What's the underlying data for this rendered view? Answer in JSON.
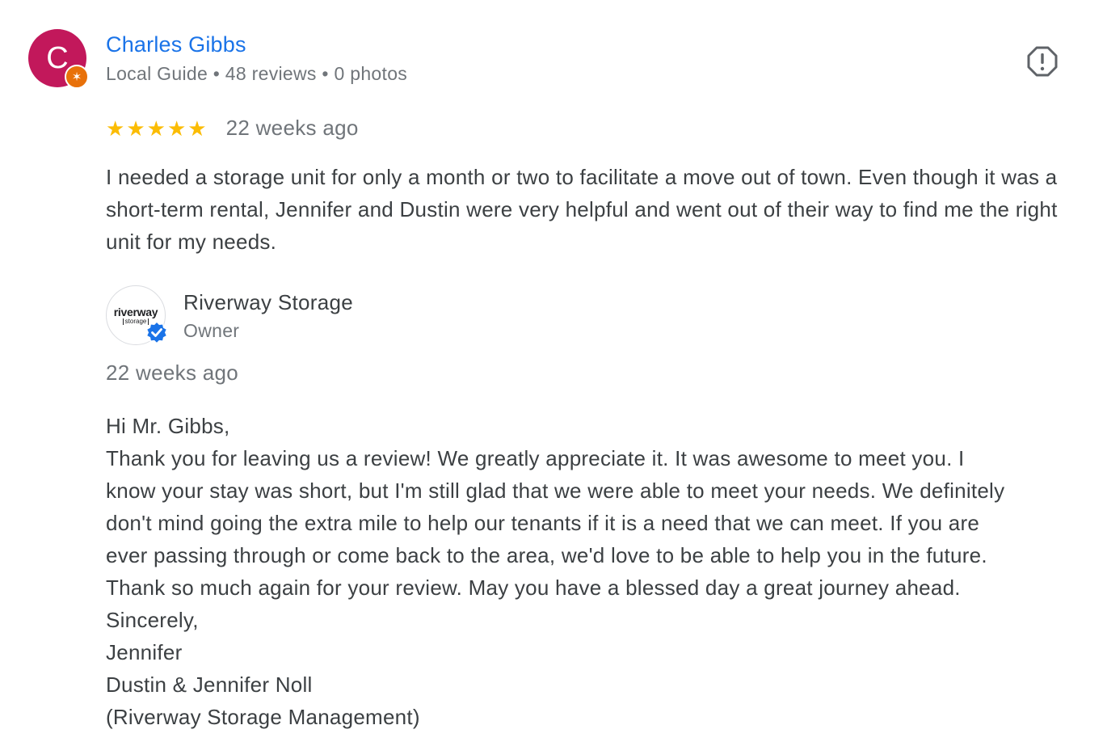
{
  "review": {
    "reviewer": {
      "initial": "C",
      "name": "Charles Gibbs",
      "meta": "Local Guide • 48 reviews • 0 photos",
      "badge_icon": "local-guide-star-icon",
      "avatar_color": "#c2185b",
      "badge_color": "#e8710a"
    },
    "rating": 5,
    "stars": [
      "★",
      "★",
      "★",
      "★",
      "★"
    ],
    "time": "22 weeks ago",
    "text": "I needed a storage unit for only a month or two to facilitate a move out of town. Even though it was a short-term rental, Jennifer and Dustin were very helpful and went out of their way to find me the right unit for my needs.",
    "flag_icon": "report-flag-icon"
  },
  "response": {
    "logo_word": "riverway",
    "logo_sub": "storage",
    "name": "Riverway Storage",
    "role": "Owner",
    "verified_icon": "verified-check-icon",
    "time": "22 weeks ago",
    "lines": [
      "Hi Mr. Gibbs,",
      "Thank you for leaving us a review! We greatly appreciate it. It was awesome to meet you. I",
      "know your stay was short, but I'm still glad that we were able to meet your needs. We definitely",
      "don't mind going the extra mile to help our tenants if it is a need that we can meet. If you are",
      "ever passing through or come back to the area, we'd love to be able to help you in the future.",
      "Thank so much again for your review. May you have a blessed day a great journey ahead.",
      "Sincerely,",
      "Jennifer",
      "Dustin & Jennifer Noll",
      "(Riverway Storage Management)"
    ]
  },
  "colors": {
    "accent": "#1a73e8",
    "star": "#fbbc04",
    "text": "#3c4043",
    "muted": "#70757a"
  }
}
